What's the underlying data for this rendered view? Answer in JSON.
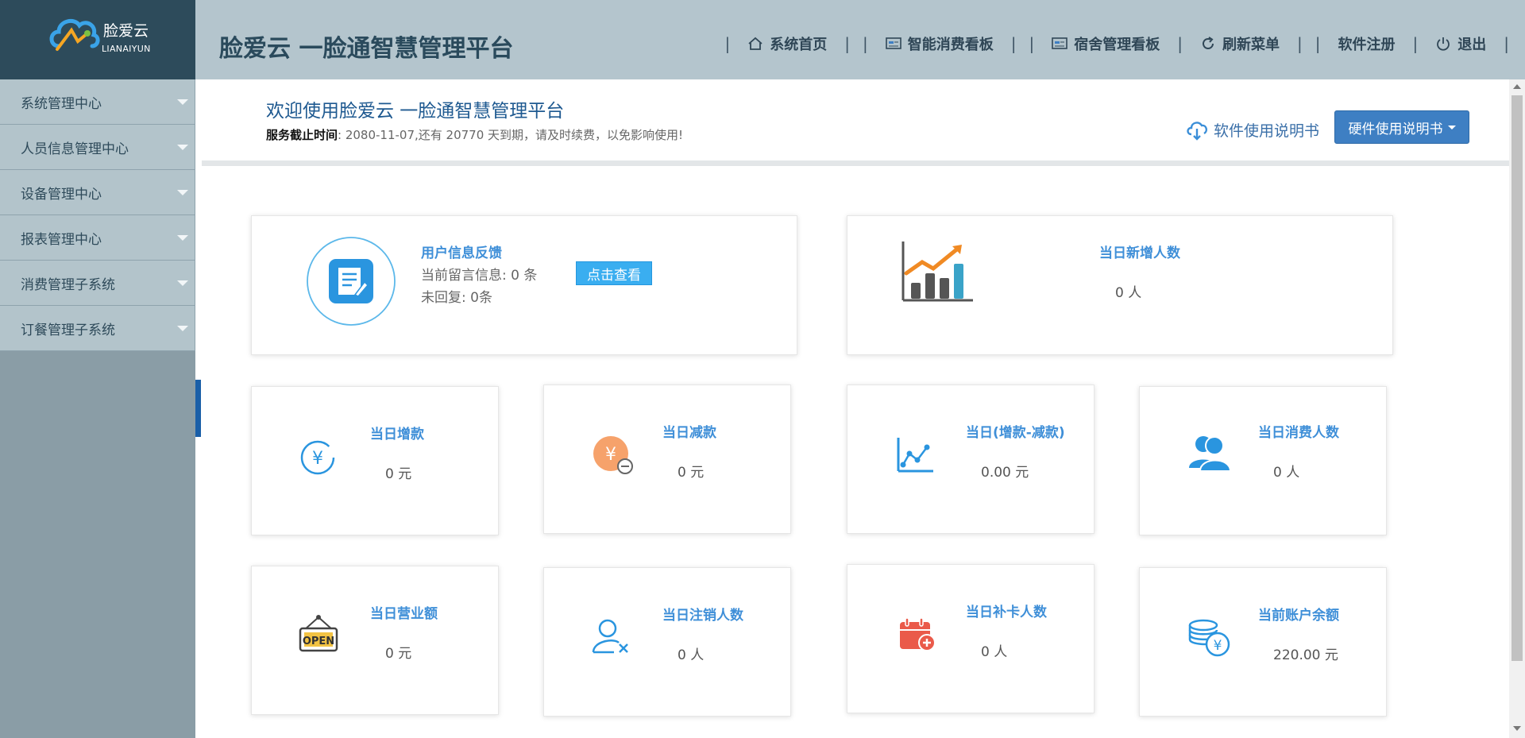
{
  "brand": {
    "name": "脸爱云",
    "sub": "LIANAIYUN",
    "title": "脸爱云 一脸通智慧管理平台"
  },
  "topnav": [
    {
      "label": "系统首页",
      "icon": "home-icon"
    },
    {
      "label": "智能消费看板",
      "icon": "dashboard-icon"
    },
    {
      "label": "宿舍管理看板",
      "icon": "dashboard-icon"
    },
    {
      "label": "刷新菜单",
      "icon": "refresh-icon"
    },
    {
      "label": "软件注册",
      "icon": ""
    },
    {
      "label": "退出",
      "icon": "power-icon"
    }
  ],
  "sidebar": {
    "items": [
      {
        "label": "系统管理中心"
      },
      {
        "label": "人员信息管理中心"
      },
      {
        "label": "设备管理中心"
      },
      {
        "label": "报表管理中心"
      },
      {
        "label": "消费管理子系统"
      },
      {
        "label": "订餐管理子系统"
      }
    ]
  },
  "welcome": {
    "title": "欢迎使用脸爱云 一脸通智慧管理平台",
    "service_label": "服务截止时间",
    "service_text": ":  2080-11-07,还有 20770 天到期，请及时续费，以免影响使用!"
  },
  "manual": {
    "software": "软件使用说明书",
    "hardware": "硬件使用说明书"
  },
  "feedback": {
    "title": "用户信息反馈",
    "messages": "当前留言信息: 0 条",
    "unreplied": "未回复: 0条",
    "button": "点击查看"
  },
  "new_users": {
    "title": "当日新增人数",
    "value": "0 人"
  },
  "stats": [
    {
      "title": "当日增款",
      "value": "0 元"
    },
    {
      "title": "当日减款",
      "value": "0 元"
    },
    {
      "title": "当日(增款-减款)",
      "value": "0.00 元"
    },
    {
      "title": "当日消费人数",
      "value": "0 人"
    },
    {
      "title": "当日营业额",
      "value": "0 元"
    },
    {
      "title": "当日注销人数",
      "value": "0 人"
    },
    {
      "title": "当日补卡人数",
      "value": "0 人"
    },
    {
      "title": "当前账户余额",
      "value": "220.00 元"
    }
  ],
  "colors": {
    "header": "#b4c5cd",
    "logo_bg": "#2d4b5b",
    "sidebar": "#b3c4cb",
    "accent": "#3f8fd8",
    "button": "#3e7fc3"
  }
}
